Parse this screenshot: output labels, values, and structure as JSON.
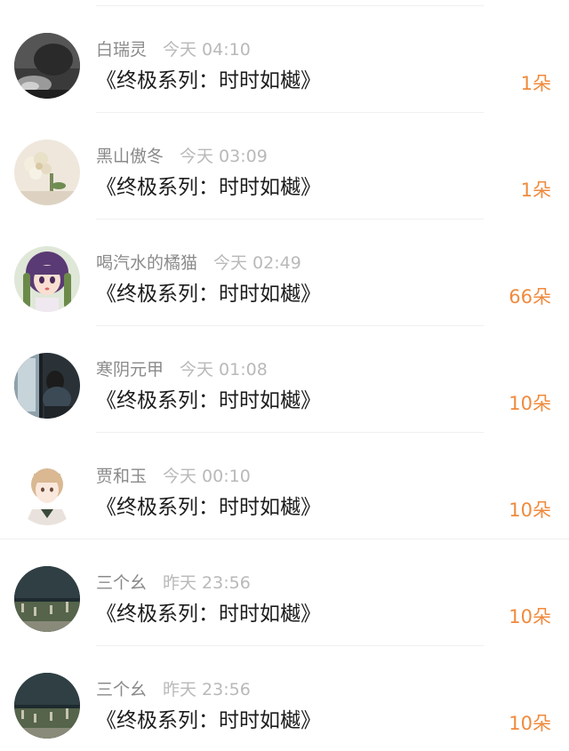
{
  "items": [
    {
      "name": "白瑞灵",
      "time": "今天 04:10",
      "title": "《终极系列：时时如樾》",
      "flowers": "1朵",
      "avatar": "dark-portrait-avatar"
    },
    {
      "name": "黑山傲冬",
      "time": "今天 03:09",
      "title": "《终极系列：时时如樾》",
      "flowers": "1朵",
      "avatar": "flowers-avatar"
    },
    {
      "name": "喝汽水的橘猫",
      "time": "今天 02:49",
      "title": "《终极系列：时时如樾》",
      "flowers": "66朵",
      "avatar": "anime-girl-avatar"
    },
    {
      "name": "寒阴元甲",
      "time": "今天 01:08",
      "title": "《终极系列：时时如樾》",
      "flowers": "10朵",
      "avatar": "window-girl-avatar"
    },
    {
      "name": "贾和玉",
      "time": "今天 00:10",
      "title": "《终极系列：时时如樾》",
      "flowers": "10朵",
      "avatar": "anime-boy-avatar"
    },
    {
      "name": "三个幺",
      "time": "昨天 23:56",
      "title": "《终极系列：时时如樾》",
      "flowers": "10朵",
      "avatar": "field-scene-avatar"
    },
    {
      "name": "三个幺",
      "time": "昨天 23:56",
      "title": "《终极系列：时时如樾》",
      "flowers": "10朵",
      "avatar": "field-scene-avatar"
    }
  ],
  "colors": {
    "accent": "#f08a3c",
    "name": "#8a8a8a",
    "time": "#b9b9b9",
    "title": "#1d1d1d"
  }
}
